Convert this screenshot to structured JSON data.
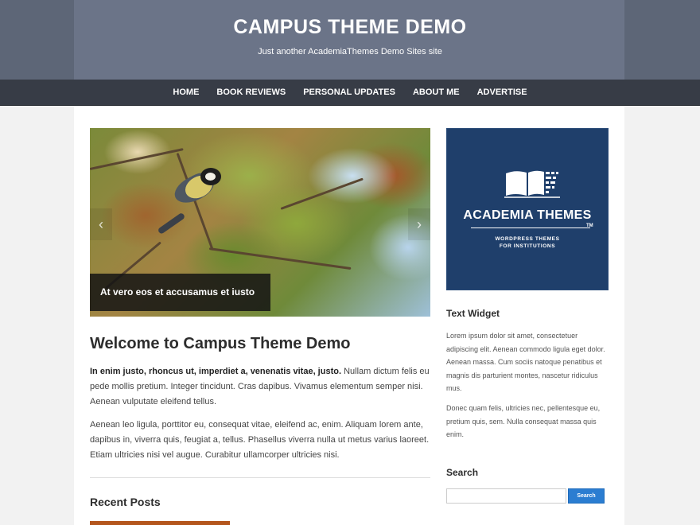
{
  "site": {
    "title": "CAMPUS THEME DEMO",
    "tagline": "Just another AcademiaThemes Demo Sites site"
  },
  "nav": {
    "items": [
      "HOME",
      "BOOK REVIEWS",
      "PERSONAL UPDATES",
      "ABOUT ME",
      "ADVERTISE"
    ]
  },
  "slider": {
    "caption": "At vero eos et accusamus et iusto odio",
    "prev_icon": "chevron-left-icon",
    "next_icon": "chevron-right-icon"
  },
  "main": {
    "title": "Welcome to Campus Theme Demo",
    "para1_bold": "In enim justo, rhoncus ut, imperdiet a, venenatis vitae, justo.",
    "para1_rest": " Nullam dictum felis eu pede mollis pretium. Integer tincidunt. Cras dapibus. Vivamus elementum semper nisi. Aenean vulputate eleifend tellus.",
    "para2": "Aenean leo ligula, porttitor eu, consequat vitae, eleifend ac, enim. Aliquam lorem ante, dapibus in, viverra quis, feugiat a, tellus. Phasellus viverra nulla ut metus varius laoreet. Etiam ultricies nisi vel augue. Curabitur ullamcorper ultricies nisi.",
    "recent_posts_title": "Recent Posts"
  },
  "sidebar": {
    "ad": {
      "title": "ACADEMIA THEMES",
      "tm": "TM",
      "sub_line1": "WORDPRESS THEMES",
      "sub_line2": "FOR INSTITUTIONS"
    },
    "text_widget": {
      "title": "Text Widget",
      "para1": "Lorem ipsum dolor sit amet, consectetuer adipiscing elit. Aenean commodo ligula eget dolor. Aenean massa. Cum sociis natoque penatibus et magnis dis parturient montes, nascetur ridiculus mus.",
      "para2": "Donec quam felis, ultricies nec, pellentesque eu, pretium quis, sem. Nulla consequat massa quis enim."
    },
    "search": {
      "title": "Search",
      "input_value": "",
      "placeholder": "",
      "button_label": "Search"
    }
  },
  "colors": {
    "header_bg": "#5d6677",
    "nav_bg": "#373c46",
    "ad_bg": "#1f3f6b",
    "search_button": "#2b7dd1",
    "recent_accent": "#b4561d"
  }
}
